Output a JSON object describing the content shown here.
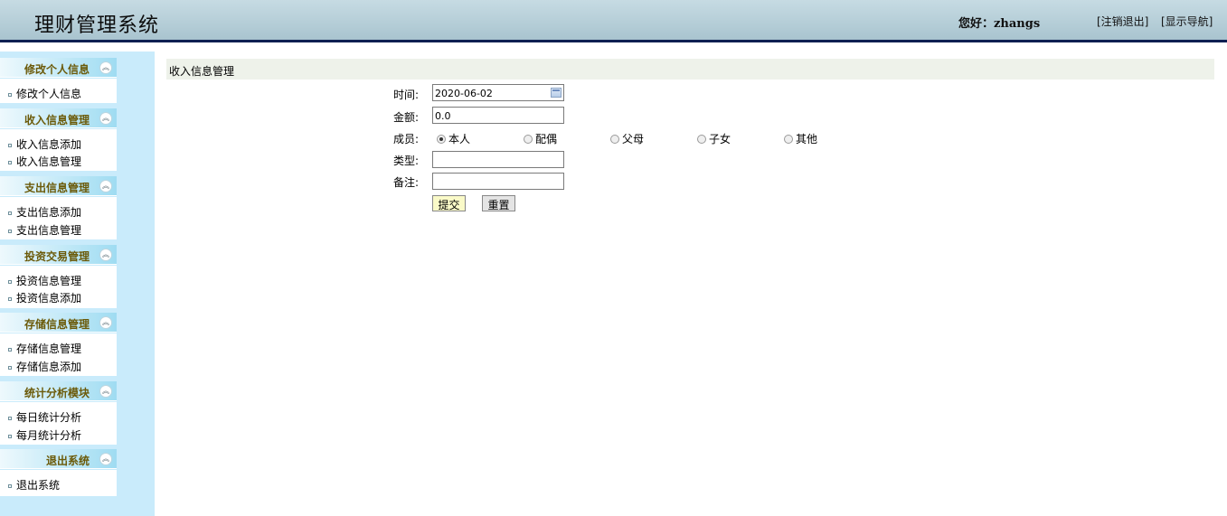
{
  "header": {
    "app_title": "理财管理系统",
    "greeting_prefix": "您好：",
    "username": "zhangs",
    "logout_link": "[注销退出]",
    "nav_link": "[显示导航]"
  },
  "sidebar": {
    "groups": [
      {
        "title": "修改个人信息",
        "items": [
          "修改个人信息"
        ]
      },
      {
        "title": "收入信息管理",
        "items": [
          "收入信息添加",
          "收入信息管理"
        ]
      },
      {
        "title": "支出信息管理",
        "items": [
          "支出信息添加",
          "支出信息管理"
        ]
      },
      {
        "title": "投资交易管理",
        "items": [
          "投资信息管理",
          "投资信息添加"
        ]
      },
      {
        "title": "存储信息管理",
        "items": [
          "存储信息管理",
          "存储信息添加"
        ]
      },
      {
        "title": "统计分析模块",
        "items": [
          "每日统计分析",
          "每月统计分析"
        ]
      },
      {
        "title": "退出系统",
        "items": [
          "退出系统"
        ]
      }
    ],
    "collapse_glyph": "︽"
  },
  "main": {
    "title": "收入信息管理",
    "form": {
      "time_label": "时间:",
      "time_value": "2020-06-02",
      "amount_label": "金额:",
      "amount_value": "0.0",
      "member_label": "成员:",
      "member_options": [
        "本人",
        "配偶",
        "父母",
        "子女",
        "其他"
      ],
      "member_selected": "本人",
      "type_label": "类型:",
      "type_value": "",
      "note_label": "备注:",
      "note_value": "",
      "submit_label": "提交",
      "reset_label": "重置"
    }
  }
}
